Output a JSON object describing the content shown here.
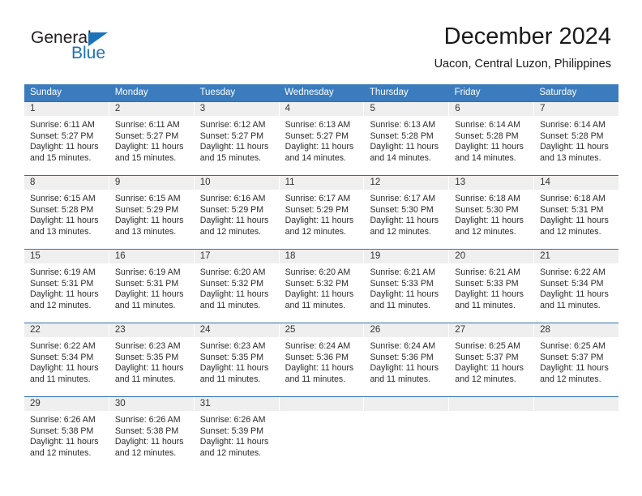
{
  "brand": {
    "name_part1": "General",
    "name_part2": "Blue",
    "triangle_color": "#1b72b8"
  },
  "header": {
    "title": "December 2024",
    "subtitle": "Uacon, Central Luzon, Philippines"
  },
  "theme": {
    "header_blue": "#3a7cbe",
    "week_divider_blue": "#2f6fae",
    "day_number_band": "#efefef",
    "text_color": "#2b2b2b"
  },
  "weekdays": [
    "Sunday",
    "Monday",
    "Tuesday",
    "Wednesday",
    "Thursday",
    "Friday",
    "Saturday"
  ],
  "weeks": [
    [
      {
        "day": "1",
        "sunrise": "Sunrise: 6:11 AM",
        "sunset": "Sunset: 5:27 PM",
        "daylight": "Daylight: 11 hours and 15 minutes."
      },
      {
        "day": "2",
        "sunrise": "Sunrise: 6:11 AM",
        "sunset": "Sunset: 5:27 PM",
        "daylight": "Daylight: 11 hours and 15 minutes."
      },
      {
        "day": "3",
        "sunrise": "Sunrise: 6:12 AM",
        "sunset": "Sunset: 5:27 PM",
        "daylight": "Daylight: 11 hours and 15 minutes."
      },
      {
        "day": "4",
        "sunrise": "Sunrise: 6:13 AM",
        "sunset": "Sunset: 5:27 PM",
        "daylight": "Daylight: 11 hours and 14 minutes."
      },
      {
        "day": "5",
        "sunrise": "Sunrise: 6:13 AM",
        "sunset": "Sunset: 5:28 PM",
        "daylight": "Daylight: 11 hours and 14 minutes."
      },
      {
        "day": "6",
        "sunrise": "Sunrise: 6:14 AM",
        "sunset": "Sunset: 5:28 PM",
        "daylight": "Daylight: 11 hours and 14 minutes."
      },
      {
        "day": "7",
        "sunrise": "Sunrise: 6:14 AM",
        "sunset": "Sunset: 5:28 PM",
        "daylight": "Daylight: 11 hours and 13 minutes."
      }
    ],
    [
      {
        "day": "8",
        "sunrise": "Sunrise: 6:15 AM",
        "sunset": "Sunset: 5:28 PM",
        "daylight": "Daylight: 11 hours and 13 minutes."
      },
      {
        "day": "9",
        "sunrise": "Sunrise: 6:15 AM",
        "sunset": "Sunset: 5:29 PM",
        "daylight": "Daylight: 11 hours and 13 minutes."
      },
      {
        "day": "10",
        "sunrise": "Sunrise: 6:16 AM",
        "sunset": "Sunset: 5:29 PM",
        "daylight": "Daylight: 11 hours and 12 minutes."
      },
      {
        "day": "11",
        "sunrise": "Sunrise: 6:17 AM",
        "sunset": "Sunset: 5:29 PM",
        "daylight": "Daylight: 11 hours and 12 minutes."
      },
      {
        "day": "12",
        "sunrise": "Sunrise: 6:17 AM",
        "sunset": "Sunset: 5:30 PM",
        "daylight": "Daylight: 11 hours and 12 minutes."
      },
      {
        "day": "13",
        "sunrise": "Sunrise: 6:18 AM",
        "sunset": "Sunset: 5:30 PM",
        "daylight": "Daylight: 11 hours and 12 minutes."
      },
      {
        "day": "14",
        "sunrise": "Sunrise: 6:18 AM",
        "sunset": "Sunset: 5:31 PM",
        "daylight": "Daylight: 11 hours and 12 minutes."
      }
    ],
    [
      {
        "day": "15",
        "sunrise": "Sunrise: 6:19 AM",
        "sunset": "Sunset: 5:31 PM",
        "daylight": "Daylight: 11 hours and 12 minutes."
      },
      {
        "day": "16",
        "sunrise": "Sunrise: 6:19 AM",
        "sunset": "Sunset: 5:31 PM",
        "daylight": "Daylight: 11 hours and 11 minutes."
      },
      {
        "day": "17",
        "sunrise": "Sunrise: 6:20 AM",
        "sunset": "Sunset: 5:32 PM",
        "daylight": "Daylight: 11 hours and 11 minutes."
      },
      {
        "day": "18",
        "sunrise": "Sunrise: 6:20 AM",
        "sunset": "Sunset: 5:32 PM",
        "daylight": "Daylight: 11 hours and 11 minutes."
      },
      {
        "day": "19",
        "sunrise": "Sunrise: 6:21 AM",
        "sunset": "Sunset: 5:33 PM",
        "daylight": "Daylight: 11 hours and 11 minutes."
      },
      {
        "day": "20",
        "sunrise": "Sunrise: 6:21 AM",
        "sunset": "Sunset: 5:33 PM",
        "daylight": "Daylight: 11 hours and 11 minutes."
      },
      {
        "day": "21",
        "sunrise": "Sunrise: 6:22 AM",
        "sunset": "Sunset: 5:34 PM",
        "daylight": "Daylight: 11 hours and 11 minutes."
      }
    ],
    [
      {
        "day": "22",
        "sunrise": "Sunrise: 6:22 AM",
        "sunset": "Sunset: 5:34 PM",
        "daylight": "Daylight: 11 hours and 11 minutes."
      },
      {
        "day": "23",
        "sunrise": "Sunrise: 6:23 AM",
        "sunset": "Sunset: 5:35 PM",
        "daylight": "Daylight: 11 hours and 11 minutes."
      },
      {
        "day": "24",
        "sunrise": "Sunrise: 6:23 AM",
        "sunset": "Sunset: 5:35 PM",
        "daylight": "Daylight: 11 hours and 11 minutes."
      },
      {
        "day": "25",
        "sunrise": "Sunrise: 6:24 AM",
        "sunset": "Sunset: 5:36 PM",
        "daylight": "Daylight: 11 hours and 11 minutes."
      },
      {
        "day": "26",
        "sunrise": "Sunrise: 6:24 AM",
        "sunset": "Sunset: 5:36 PM",
        "daylight": "Daylight: 11 hours and 11 minutes."
      },
      {
        "day": "27",
        "sunrise": "Sunrise: 6:25 AM",
        "sunset": "Sunset: 5:37 PM",
        "daylight": "Daylight: 11 hours and 12 minutes."
      },
      {
        "day": "28",
        "sunrise": "Sunrise: 6:25 AM",
        "sunset": "Sunset: 5:37 PM",
        "daylight": "Daylight: 11 hours and 12 minutes."
      }
    ],
    [
      {
        "day": "29",
        "sunrise": "Sunrise: 6:26 AM",
        "sunset": "Sunset: 5:38 PM",
        "daylight": "Daylight: 11 hours and 12 minutes."
      },
      {
        "day": "30",
        "sunrise": "Sunrise: 6:26 AM",
        "sunset": "Sunset: 5:38 PM",
        "daylight": "Daylight: 11 hours and 12 minutes."
      },
      {
        "day": "31",
        "sunrise": "Sunrise: 6:26 AM",
        "sunset": "Sunset: 5:39 PM",
        "daylight": "Daylight: 11 hours and 12 minutes."
      },
      {
        "day": "",
        "sunrise": "",
        "sunset": "",
        "daylight": ""
      },
      {
        "day": "",
        "sunrise": "",
        "sunset": "",
        "daylight": ""
      },
      {
        "day": "",
        "sunrise": "",
        "sunset": "",
        "daylight": ""
      },
      {
        "day": "",
        "sunrise": "",
        "sunset": "",
        "daylight": ""
      }
    ]
  ]
}
